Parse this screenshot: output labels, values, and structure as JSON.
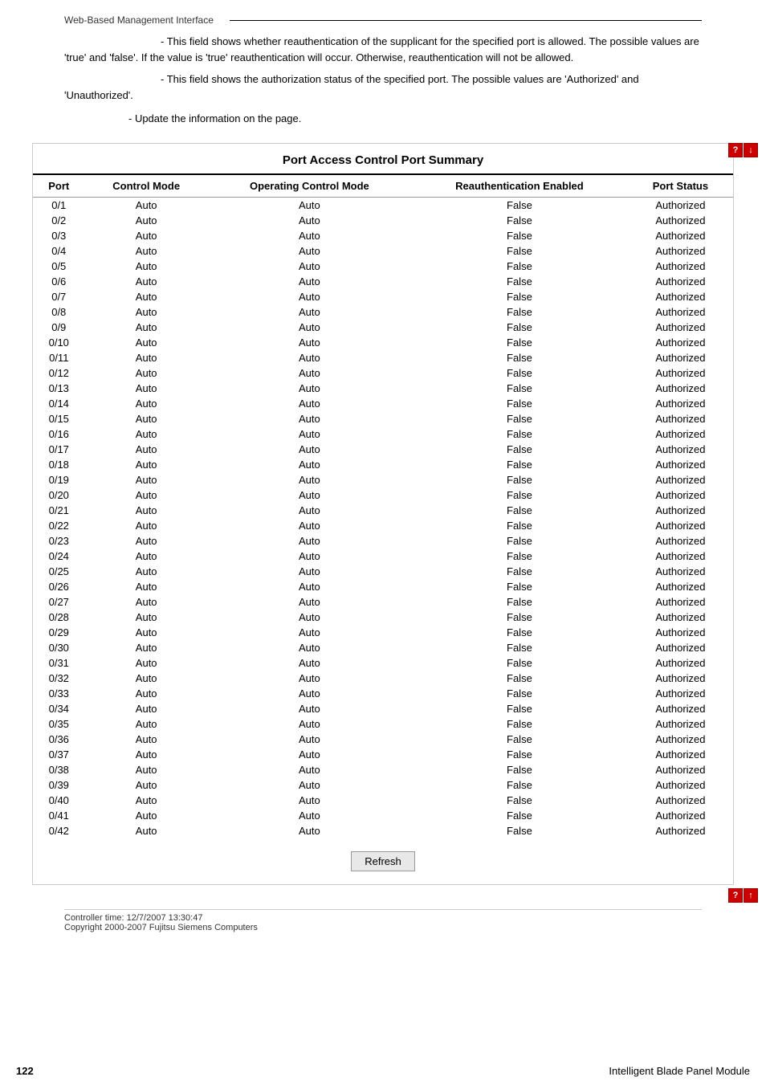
{
  "header": {
    "title": "Web-Based Management Interface",
    "divider_line": true
  },
  "descriptions": {
    "reauth_field": "- This field shows whether reauthentication of the supplicant for the specified port is allowed. The possible values are 'true' and 'false'. If the value is 'true' reauthentication will occur. Otherwise, reauthentication will not be allowed.",
    "port_status_field": "- This field shows the authorization status of the specified port. The possible values are 'Authorized' and 'Unauthorized'.",
    "refresh_desc": "- Update the information on the page."
  },
  "table": {
    "title": "Port Access Control Port Summary",
    "columns": [
      "Port",
      "Control Mode",
      "Operating Control Mode",
      "Reauthentication Enabled",
      "Port Status"
    ],
    "rows": [
      {
        "port": "0/1",
        "control_mode": "Auto",
        "operating_control_mode": "Auto",
        "reauth_enabled": "False",
        "port_status": "Authorized"
      },
      {
        "port": "0/2",
        "control_mode": "Auto",
        "operating_control_mode": "Auto",
        "reauth_enabled": "False",
        "port_status": "Authorized"
      },
      {
        "port": "0/3",
        "control_mode": "Auto",
        "operating_control_mode": "Auto",
        "reauth_enabled": "False",
        "port_status": "Authorized"
      },
      {
        "port": "0/4",
        "control_mode": "Auto",
        "operating_control_mode": "Auto",
        "reauth_enabled": "False",
        "port_status": "Authorized"
      },
      {
        "port": "0/5",
        "control_mode": "Auto",
        "operating_control_mode": "Auto",
        "reauth_enabled": "False",
        "port_status": "Authorized"
      },
      {
        "port": "0/6",
        "control_mode": "Auto",
        "operating_control_mode": "Auto",
        "reauth_enabled": "False",
        "port_status": "Authorized"
      },
      {
        "port": "0/7",
        "control_mode": "Auto",
        "operating_control_mode": "Auto",
        "reauth_enabled": "False",
        "port_status": "Authorized"
      },
      {
        "port": "0/8",
        "control_mode": "Auto",
        "operating_control_mode": "Auto",
        "reauth_enabled": "False",
        "port_status": "Authorized"
      },
      {
        "port": "0/9",
        "control_mode": "Auto",
        "operating_control_mode": "Auto",
        "reauth_enabled": "False",
        "port_status": "Authorized"
      },
      {
        "port": "0/10",
        "control_mode": "Auto",
        "operating_control_mode": "Auto",
        "reauth_enabled": "False",
        "port_status": "Authorized"
      },
      {
        "port": "0/11",
        "control_mode": "Auto",
        "operating_control_mode": "Auto",
        "reauth_enabled": "False",
        "port_status": "Authorized"
      },
      {
        "port": "0/12",
        "control_mode": "Auto",
        "operating_control_mode": "Auto",
        "reauth_enabled": "False",
        "port_status": "Authorized"
      },
      {
        "port": "0/13",
        "control_mode": "Auto",
        "operating_control_mode": "Auto",
        "reauth_enabled": "False",
        "port_status": "Authorized"
      },
      {
        "port": "0/14",
        "control_mode": "Auto",
        "operating_control_mode": "Auto",
        "reauth_enabled": "False",
        "port_status": "Authorized"
      },
      {
        "port": "0/15",
        "control_mode": "Auto",
        "operating_control_mode": "Auto",
        "reauth_enabled": "False",
        "port_status": "Authorized"
      },
      {
        "port": "0/16",
        "control_mode": "Auto",
        "operating_control_mode": "Auto",
        "reauth_enabled": "False",
        "port_status": "Authorized"
      },
      {
        "port": "0/17",
        "control_mode": "Auto",
        "operating_control_mode": "Auto",
        "reauth_enabled": "False",
        "port_status": "Authorized"
      },
      {
        "port": "0/18",
        "control_mode": "Auto",
        "operating_control_mode": "Auto",
        "reauth_enabled": "False",
        "port_status": "Authorized"
      },
      {
        "port": "0/19",
        "control_mode": "Auto",
        "operating_control_mode": "Auto",
        "reauth_enabled": "False",
        "port_status": "Authorized"
      },
      {
        "port": "0/20",
        "control_mode": "Auto",
        "operating_control_mode": "Auto",
        "reauth_enabled": "False",
        "port_status": "Authorized"
      },
      {
        "port": "0/21",
        "control_mode": "Auto",
        "operating_control_mode": "Auto",
        "reauth_enabled": "False",
        "port_status": "Authorized"
      },
      {
        "port": "0/22",
        "control_mode": "Auto",
        "operating_control_mode": "Auto",
        "reauth_enabled": "False",
        "port_status": "Authorized"
      },
      {
        "port": "0/23",
        "control_mode": "Auto",
        "operating_control_mode": "Auto",
        "reauth_enabled": "False",
        "port_status": "Authorized"
      },
      {
        "port": "0/24",
        "control_mode": "Auto",
        "operating_control_mode": "Auto",
        "reauth_enabled": "False",
        "port_status": "Authorized"
      },
      {
        "port": "0/25",
        "control_mode": "Auto",
        "operating_control_mode": "Auto",
        "reauth_enabled": "False",
        "port_status": "Authorized"
      },
      {
        "port": "0/26",
        "control_mode": "Auto",
        "operating_control_mode": "Auto",
        "reauth_enabled": "False",
        "port_status": "Authorized"
      },
      {
        "port": "0/27",
        "control_mode": "Auto",
        "operating_control_mode": "Auto",
        "reauth_enabled": "False",
        "port_status": "Authorized"
      },
      {
        "port": "0/28",
        "control_mode": "Auto",
        "operating_control_mode": "Auto",
        "reauth_enabled": "False",
        "port_status": "Authorized"
      },
      {
        "port": "0/29",
        "control_mode": "Auto",
        "operating_control_mode": "Auto",
        "reauth_enabled": "False",
        "port_status": "Authorized"
      },
      {
        "port": "0/30",
        "control_mode": "Auto",
        "operating_control_mode": "Auto",
        "reauth_enabled": "False",
        "port_status": "Authorized"
      },
      {
        "port": "0/31",
        "control_mode": "Auto",
        "operating_control_mode": "Auto",
        "reauth_enabled": "False",
        "port_status": "Authorized"
      },
      {
        "port": "0/32",
        "control_mode": "Auto",
        "operating_control_mode": "Auto",
        "reauth_enabled": "False",
        "port_status": "Authorized"
      },
      {
        "port": "0/33",
        "control_mode": "Auto",
        "operating_control_mode": "Auto",
        "reauth_enabled": "False",
        "port_status": "Authorized"
      },
      {
        "port": "0/34",
        "control_mode": "Auto",
        "operating_control_mode": "Auto",
        "reauth_enabled": "False",
        "port_status": "Authorized"
      },
      {
        "port": "0/35",
        "control_mode": "Auto",
        "operating_control_mode": "Auto",
        "reauth_enabled": "False",
        "port_status": "Authorized"
      },
      {
        "port": "0/36",
        "control_mode": "Auto",
        "operating_control_mode": "Auto",
        "reauth_enabled": "False",
        "port_status": "Authorized"
      },
      {
        "port": "0/37",
        "control_mode": "Auto",
        "operating_control_mode": "Auto",
        "reauth_enabled": "False",
        "port_status": "Authorized"
      },
      {
        "port": "0/38",
        "control_mode": "Auto",
        "operating_control_mode": "Auto",
        "reauth_enabled": "False",
        "port_status": "Authorized"
      },
      {
        "port": "0/39",
        "control_mode": "Auto",
        "operating_control_mode": "Auto",
        "reauth_enabled": "False",
        "port_status": "Authorized"
      },
      {
        "port": "0/40",
        "control_mode": "Auto",
        "operating_control_mode": "Auto",
        "reauth_enabled": "False",
        "port_status": "Authorized"
      },
      {
        "port": "0/41",
        "control_mode": "Auto",
        "operating_control_mode": "Auto",
        "reauth_enabled": "False",
        "port_status": "Authorized"
      },
      {
        "port": "0/42",
        "control_mode": "Auto",
        "operating_control_mode": "Auto",
        "reauth_enabled": "False",
        "port_status": "Authorized"
      }
    ]
  },
  "buttons": {
    "refresh_label": "Refresh"
  },
  "footer": {
    "controller_time_label": "Controller time: 12/7/2007 13:30:47",
    "copyright": "Copyright 2000-2007 Fujitsu Siemens Computers",
    "page_number": "122",
    "product_name": "Intelligent Blade Panel Module"
  }
}
